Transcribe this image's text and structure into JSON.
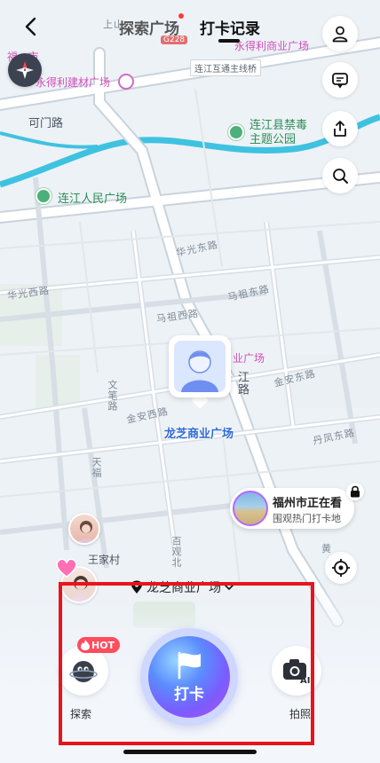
{
  "nav": {
    "tab_explore": "探索广场",
    "tab_checkin_record": "打卡记录",
    "active_tab": "打卡记录"
  },
  "map": {
    "labels": {
      "shangshan": "上山",
      "road_badge": "G228",
      "yongdeli_commercial": "永得利商业广场",
      "lianjiang_interchange": "连江互通主线桥",
      "fuzhou_market": "福...市",
      "yongdeli_building": "永得利建材广场",
      "kemen_road": "可门路",
      "jindu_park": "连江县禁毒\n主题公园",
      "renmin_square": "连江人民广场",
      "huaguang_east": "华光东路",
      "huaguang_west": "华光西路",
      "mazu_east": "马祖东路",
      "mazu_west": "马祖西路",
      "commercial_plaza": "业广场",
      "jinan_east": "金安东路",
      "jinan_west": "金安西路",
      "wenbi_road": "文笔路",
      "jiangbin_road": "江路",
      "danfeng_east": "丹凤东路",
      "tianfu": "天福",
      "baiguan_north": "百观北",
      "shuxi": "黄"
    }
  },
  "place": {
    "name": "龙芝商业广场"
  },
  "city_card": {
    "title": "福州市正在看",
    "subtitle": "围观热门打卡地"
  },
  "village": {
    "name": "王家村"
  },
  "location_chip": {
    "text": "龙芝商业广场"
  },
  "actions": {
    "hot_badge": "HOT",
    "explore_label": "探索",
    "checkin_label": "打卡",
    "photo_label": "拍照",
    "photo_badge": "AI"
  },
  "icons": {
    "back": "chevron-left-icon",
    "profile": "user-icon",
    "message": "message-icon",
    "share": "share-icon",
    "search": "search-icon",
    "compass": "compass-icon",
    "lock": "lock-icon",
    "locate": "locate-icon",
    "pin": "map-pin-icon",
    "flag": "flag-icon",
    "camera": "camera-icon",
    "flame": "flame-icon"
  },
  "colors": {
    "accent_blue": "#2f6bd6",
    "hot_red": "#ff4d5e",
    "highlight_red": "#e8141b",
    "checkin_purple": "#7a5cff"
  }
}
